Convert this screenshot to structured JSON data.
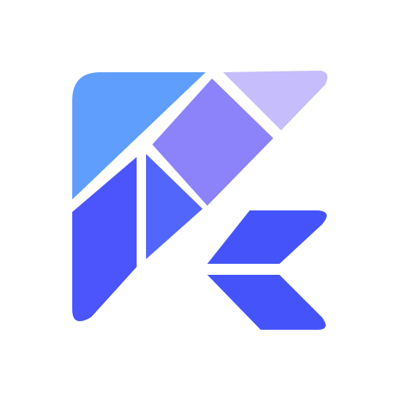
{
  "logo": {
    "icon": "tangram-k-logo-icon",
    "colors": {
      "background": "#ffffff",
      "sky_blue": "#5f9efc",
      "lavender_light": "#c5bdfc",
      "purple_mid": "#8c82f9",
      "indigo_mid": "#5366fb",
      "blue_deep": "#4b55fb",
      "blue_arrow": "#4554fa"
    }
  }
}
